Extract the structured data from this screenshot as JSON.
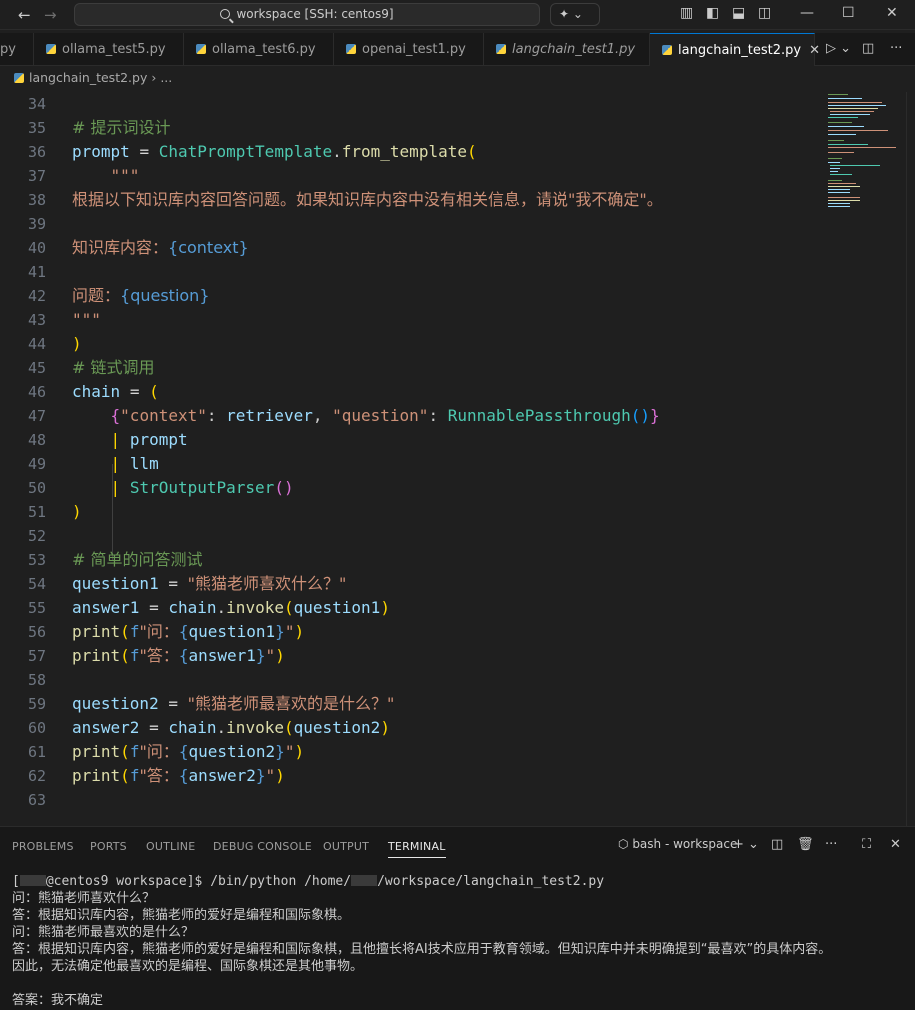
{
  "titlebar": {
    "search_text": "workspace [SSH: centos9]"
  },
  "tabs": [
    {
      "label": "py",
      "active": false,
      "italic": false
    },
    {
      "label": "ollama_test5.py",
      "active": false,
      "italic": false
    },
    {
      "label": "ollama_test6.py",
      "active": false,
      "italic": false
    },
    {
      "label": "openai_test1.py",
      "active": false,
      "italic": false
    },
    {
      "label": "langchain_test1.py",
      "active": false,
      "italic": true
    },
    {
      "label": "langchain_test2.py",
      "active": true,
      "italic": false
    }
  ],
  "breadcrumb": {
    "file": "langchain_test2.py",
    "rest": "..."
  },
  "editor": {
    "lines": [
      {
        "n": "34",
        "code": ""
      },
      {
        "n": "35",
        "code": "# 提示词设计"
      },
      {
        "n": "36",
        "code": "prompt = ChatPromptTemplate.from_template("
      },
      {
        "n": "37",
        "code": "    \"\"\""
      },
      {
        "n": "38",
        "code": "根据以下知识库内容回答问题。如果知识库内容中没有相关信息，请说\"我不确定\"。"
      },
      {
        "n": "39",
        "code": ""
      },
      {
        "n": "40",
        "code": "知识库内容：{context}"
      },
      {
        "n": "41",
        "code": ""
      },
      {
        "n": "42",
        "code": "问题：{question}"
      },
      {
        "n": "43",
        "code": "\"\"\""
      },
      {
        "n": "44",
        "code": ")"
      },
      {
        "n": "45",
        "code": "# 链式调用"
      },
      {
        "n": "46",
        "code": "chain = ("
      },
      {
        "n": "47",
        "code": "    {\"context\": retriever, \"question\": RunnablePassthrough()}"
      },
      {
        "n": "48",
        "code": "    | prompt"
      },
      {
        "n": "49",
        "code": "    | llm"
      },
      {
        "n": "50",
        "code": "    | StrOutputParser()"
      },
      {
        "n": "51",
        "code": ")"
      },
      {
        "n": "52",
        "code": ""
      },
      {
        "n": "53",
        "code": "# 简单的问答测试"
      },
      {
        "n": "54",
        "code": "question1 = \"熊猫老师喜欢什么？\""
      },
      {
        "n": "55",
        "code": "answer1 = chain.invoke(question1)"
      },
      {
        "n": "56",
        "code": "print(f\"问：{question1}\")"
      },
      {
        "n": "57",
        "code": "print(f\"答：{answer1}\")"
      },
      {
        "n": "58",
        "code": ""
      },
      {
        "n": "59",
        "code": "question2 = \"熊猫老师最喜欢的是什么？\""
      },
      {
        "n": "60",
        "code": "answer2 = chain.invoke(question2)"
      },
      {
        "n": "61",
        "code": "print(f\"问：{question2}\")"
      },
      {
        "n": "62",
        "code": "print(f\"答：{answer2}\")"
      },
      {
        "n": "63",
        "code": ""
      }
    ]
  },
  "panel": {
    "tabs": [
      "PROBLEMS",
      "PORTS",
      "OUTLINE",
      "DEBUG CONSOLE",
      "OUTPUT",
      "TERMINAL"
    ],
    "active_tab": "TERMINAL",
    "terminal_name": "bash - workspace"
  },
  "terminal": {
    "prompt_prefix": "[",
    "prompt_host": "@centos9 workspace]$ /bin/python /home/",
    "prompt_suffix": "/workspace/langchain_test2.py",
    "output": [
      "问：熊猫老师喜欢什么？",
      "答：根据知识库内容，熊猫老师的爱好是编程和国际象棋。",
      "问：熊猫老师最喜欢的是什么？",
      "答：根据知识库内容，熊猫老师的爱好是编程和国际象棋，且他擅长将AI技术应用于教育领域。但知识库中并未明确提到“最喜欢”的具体内容。",
      "因此，无法确定他最喜欢的是编程、国际象棋还是其他事物。",
      "",
      "答案：我不确定"
    ]
  }
}
